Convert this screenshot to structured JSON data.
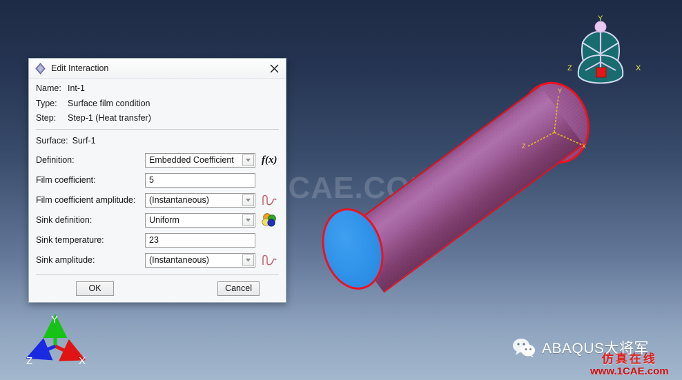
{
  "viewport": {
    "watermark_center": "1CAE.COM",
    "background_top_color": "#1e2b46",
    "background_bottom_color": "#a3b7cd",
    "axis_triad": {
      "x_label": "X",
      "y_label": "Y",
      "z_label": "Z",
      "x_color": "#e01414",
      "y_color": "#16c216",
      "z_color": "#1a2ae0"
    },
    "view_cube": {
      "x_label": "X",
      "y_label": "Y",
      "z_label": "Z",
      "face_color": "#186b6e",
      "label_color": "#e8e840"
    },
    "model": {
      "name": "cylinder",
      "body_color": "#a25f9e",
      "highlight_edge_color": "#f01020",
      "near_cap_color": "#2f92e8",
      "datum_triad_color": "#e8c020",
      "datum_labels": [
        "Y",
        "X",
        "Z"
      ]
    }
  },
  "branding": {
    "wechat_icon": "wechat-icon",
    "account_name": "ABAQUS大将军",
    "logo_cn": "仿真在线",
    "logo_url": "www.1CAE.com",
    "logo_color": "#e02020"
  },
  "dialog": {
    "icon": "abaqus-diamond-icon",
    "title": "Edit Interaction",
    "close_label": "×",
    "info": [
      {
        "label": "Name:",
        "value": "Int-1"
      },
      {
        "label": "Type:",
        "value": "Surface film condition"
      },
      {
        "label": "Step:",
        "value": "Step-1 (Heat transfer)"
      }
    ],
    "surface": {
      "label": "Surface:",
      "value": "Surf-1"
    },
    "fields": [
      {
        "label": "Definition:",
        "control": "combo",
        "value": "Embedded Coefficient",
        "trailing_icon": "fx-icon",
        "trailing_text": "f(x)"
      },
      {
        "label": "Film coefficient:",
        "control": "text",
        "value": "5",
        "trailing_icon": "none",
        "trailing_text": ""
      },
      {
        "label": "Film coefficient amplitude:",
        "control": "combo",
        "value": "(Instantaneous)",
        "trailing_icon": "amplitude-wave-icon",
        "trailing_text": ""
      },
      {
        "label": "Sink definition:",
        "control": "combo",
        "value": "Uniform",
        "trailing_icon": "color-balls-icon",
        "trailing_text": ""
      },
      {
        "label": "Sink temperature:",
        "control": "text",
        "value": "23",
        "trailing_icon": "none",
        "trailing_text": ""
      },
      {
        "label": "Sink amplitude:",
        "control": "combo",
        "value": "(Instantaneous)",
        "trailing_icon": "amplitude-wave-icon",
        "trailing_text": ""
      }
    ],
    "buttons": {
      "ok": "OK",
      "cancel": "Cancel"
    }
  }
}
